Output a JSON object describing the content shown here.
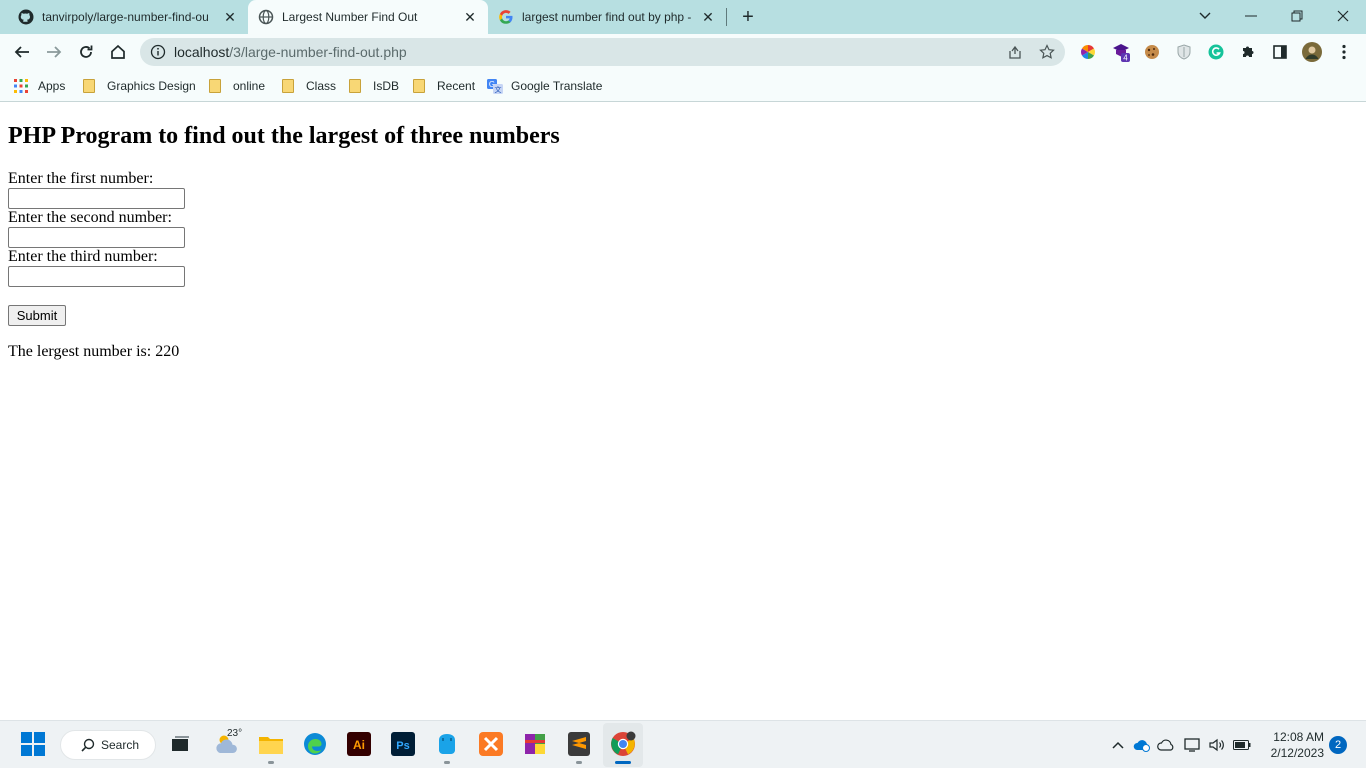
{
  "browser": {
    "tabs": [
      {
        "title": "tanvirpoly/large-number-find-ou",
        "favicon": "github-icon"
      },
      {
        "title": "Largest Number Find Out",
        "favicon": "globe-icon",
        "active": true
      },
      {
        "title": "largest number find out by php -",
        "favicon": "google-icon"
      }
    ],
    "address": {
      "host": "localhost",
      "path": "/3/large-number-find-out.php"
    },
    "bookmarks": [
      {
        "label": "Apps",
        "icon": "apps-grid-icon"
      },
      {
        "label": "Graphics Design",
        "icon": "folder-icon"
      },
      {
        "label": "online",
        "icon": "folder-icon"
      },
      {
        "label": "Class",
        "icon": "folder-icon"
      },
      {
        "label": "IsDB",
        "icon": "folder-icon"
      },
      {
        "label": "Recent",
        "icon": "folder-icon"
      },
      {
        "label": "Google Translate",
        "icon": "translate-icon"
      }
    ],
    "extension_badge": "4"
  },
  "page": {
    "heading": "PHP Program to find out the largest of three numbers",
    "fields": [
      {
        "label": "Enter the first number:",
        "value": ""
      },
      {
        "label": "Enter the second number:",
        "value": ""
      },
      {
        "label": "Enter the third number:",
        "value": ""
      }
    ],
    "submit_label": "Submit",
    "result_text": "The lergest number is: 220"
  },
  "taskbar": {
    "search_label": "Search",
    "weather_temp": "23°",
    "time": "12:08 AM",
    "date": "2/12/2023",
    "notification_count": "2"
  },
  "colors": {
    "tabstrip": "#b7dfe1",
    "toolbar": "#f6fcfc",
    "omnibox": "#d9e6e7",
    "taskbar": "#eef2f4",
    "accent": "#0067c0"
  }
}
